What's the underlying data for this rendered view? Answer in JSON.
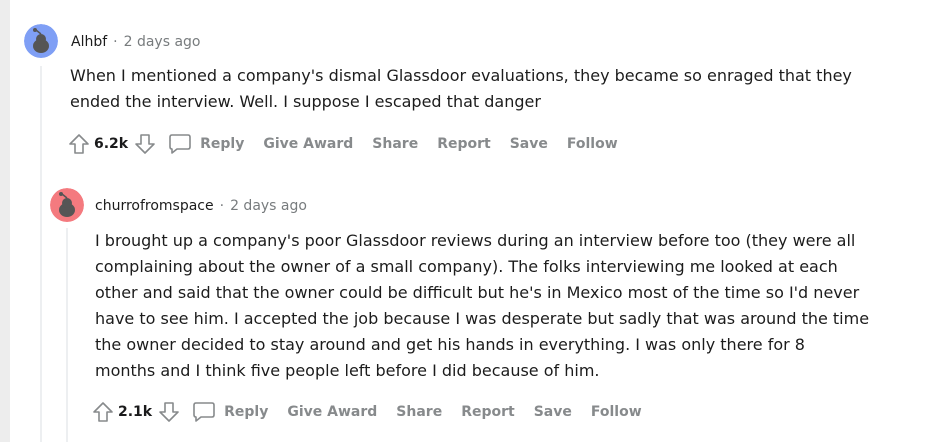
{
  "comments": [
    {
      "author": "Alhbf",
      "separator": "·",
      "age": "2 days ago",
      "body": "When I mentioned a company's dismal Glassdoor evaluations, they became so enraged that they ended the interview. Well. I suppose I escaped that danger",
      "score": "6.2k",
      "avatar_color": "#7f9ff5"
    },
    {
      "author": "churrofromspace",
      "separator": "·",
      "age": "2 days ago",
      "body": "I brought up a company's poor Glassdoor reviews during an interview before too (they were all complaining about the owner of a small company). The folks interviewing me looked at each other and said that the owner could be difficult but he's in Mexico most of the time so I'd never have to see him. I accepted the job because I was desperate but sadly that was around the time the owner decided to stay around and get his hands in everything. I was only there for 8 months and I think five people left before I did because of him.",
      "score": "2.1k",
      "avatar_color": "#f47a7f"
    }
  ],
  "actions": {
    "reply": "Reply",
    "give_award": "Give Award",
    "share": "Share",
    "report": "Report",
    "save": "Save",
    "follow": "Follow"
  },
  "icons": {
    "upvote": "upvote-arrow-icon",
    "downvote": "downvote-arrow-icon",
    "reply": "comment-bubble-icon",
    "avatar": "reddit-snoo-avatar-icon"
  }
}
